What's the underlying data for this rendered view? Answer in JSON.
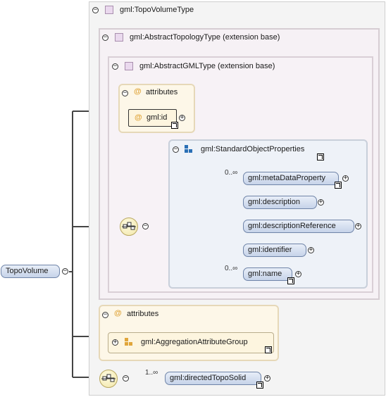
{
  "root_element": {
    "label": "TopoVolume"
  },
  "topo_volume_type": {
    "label": "gml:TopoVolumeType"
  },
  "abstract_topology_type": {
    "label": "gml:AbstractTopologyType (extension base)"
  },
  "abstract_gml_type": {
    "label": "gml:AbstractGMLType (extension base)"
  },
  "gml_attributes": {
    "label": "attributes",
    "id_attr": "gml:id"
  },
  "standard_object_properties": {
    "label": "gml:StandardObjectProperties",
    "elements": [
      {
        "label": "gml:metaDataProperty",
        "cardinality": "0..∞"
      },
      {
        "label": "gml:description",
        "cardinality": ""
      },
      {
        "label": "gml:descriptionReference",
        "cardinality": ""
      },
      {
        "label": "gml:identifier",
        "cardinality": ""
      },
      {
        "label": "gml:name",
        "cardinality": "0..∞"
      }
    ]
  },
  "aggregation_attributes": {
    "label": "attributes",
    "group": "gml:AggregationAttributeGroup"
  },
  "directed_topo_solid": {
    "label": "gml:directedTopoSolid",
    "cardinality": "1..∞"
  },
  "colors": {
    "element_fill": "#c6d3e9",
    "element_border": "#6f84a8",
    "attribute_fill": "#fdf7e8",
    "attribute_icon": "#e0a53a",
    "group_icon": "#2a6fb5",
    "wire": "#444444"
  }
}
